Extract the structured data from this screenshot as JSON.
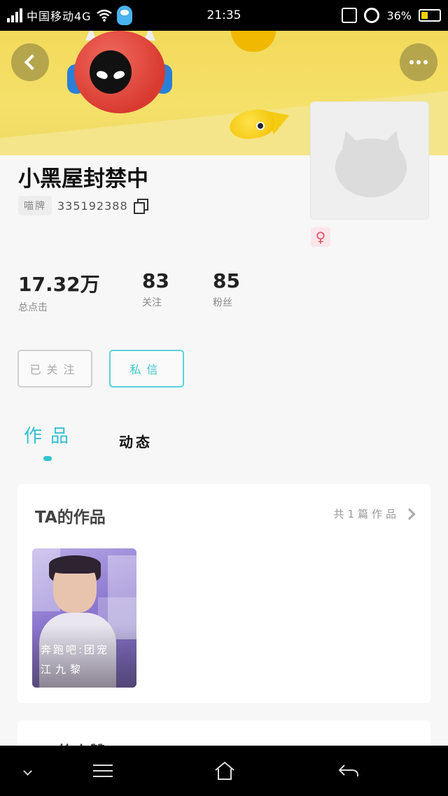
{
  "status_bar": {
    "carrier": "中国移动4G",
    "time": "21:35",
    "battery_percent": "36%",
    "battery_level": 0.36
  },
  "profile": {
    "username": "小黑屋封禁中",
    "id_tag": "喵牌",
    "id_number": "335192388",
    "gender_symbol": "♀"
  },
  "stats": [
    {
      "value": "17.32万",
      "label": "总点击"
    },
    {
      "value": "83",
      "label": "关注"
    },
    {
      "value": "85",
      "label": "粉丝"
    }
  ],
  "actions": {
    "followed_label": "已关注",
    "message_label": "私信"
  },
  "tabs": [
    {
      "label": "作品",
      "active": true
    },
    {
      "label": "动态",
      "active": false
    }
  ],
  "works_section": {
    "title": "TA的作品",
    "count_text": "共1篇作品",
    "items": [
      {
        "title": "奔跑吧:团宠",
        "author": "江九黎"
      }
    ]
  },
  "second_section": {
    "title": "TA的点赞"
  },
  "colors": {
    "accent": "#33c2d0",
    "banner": "#f2da5a"
  }
}
